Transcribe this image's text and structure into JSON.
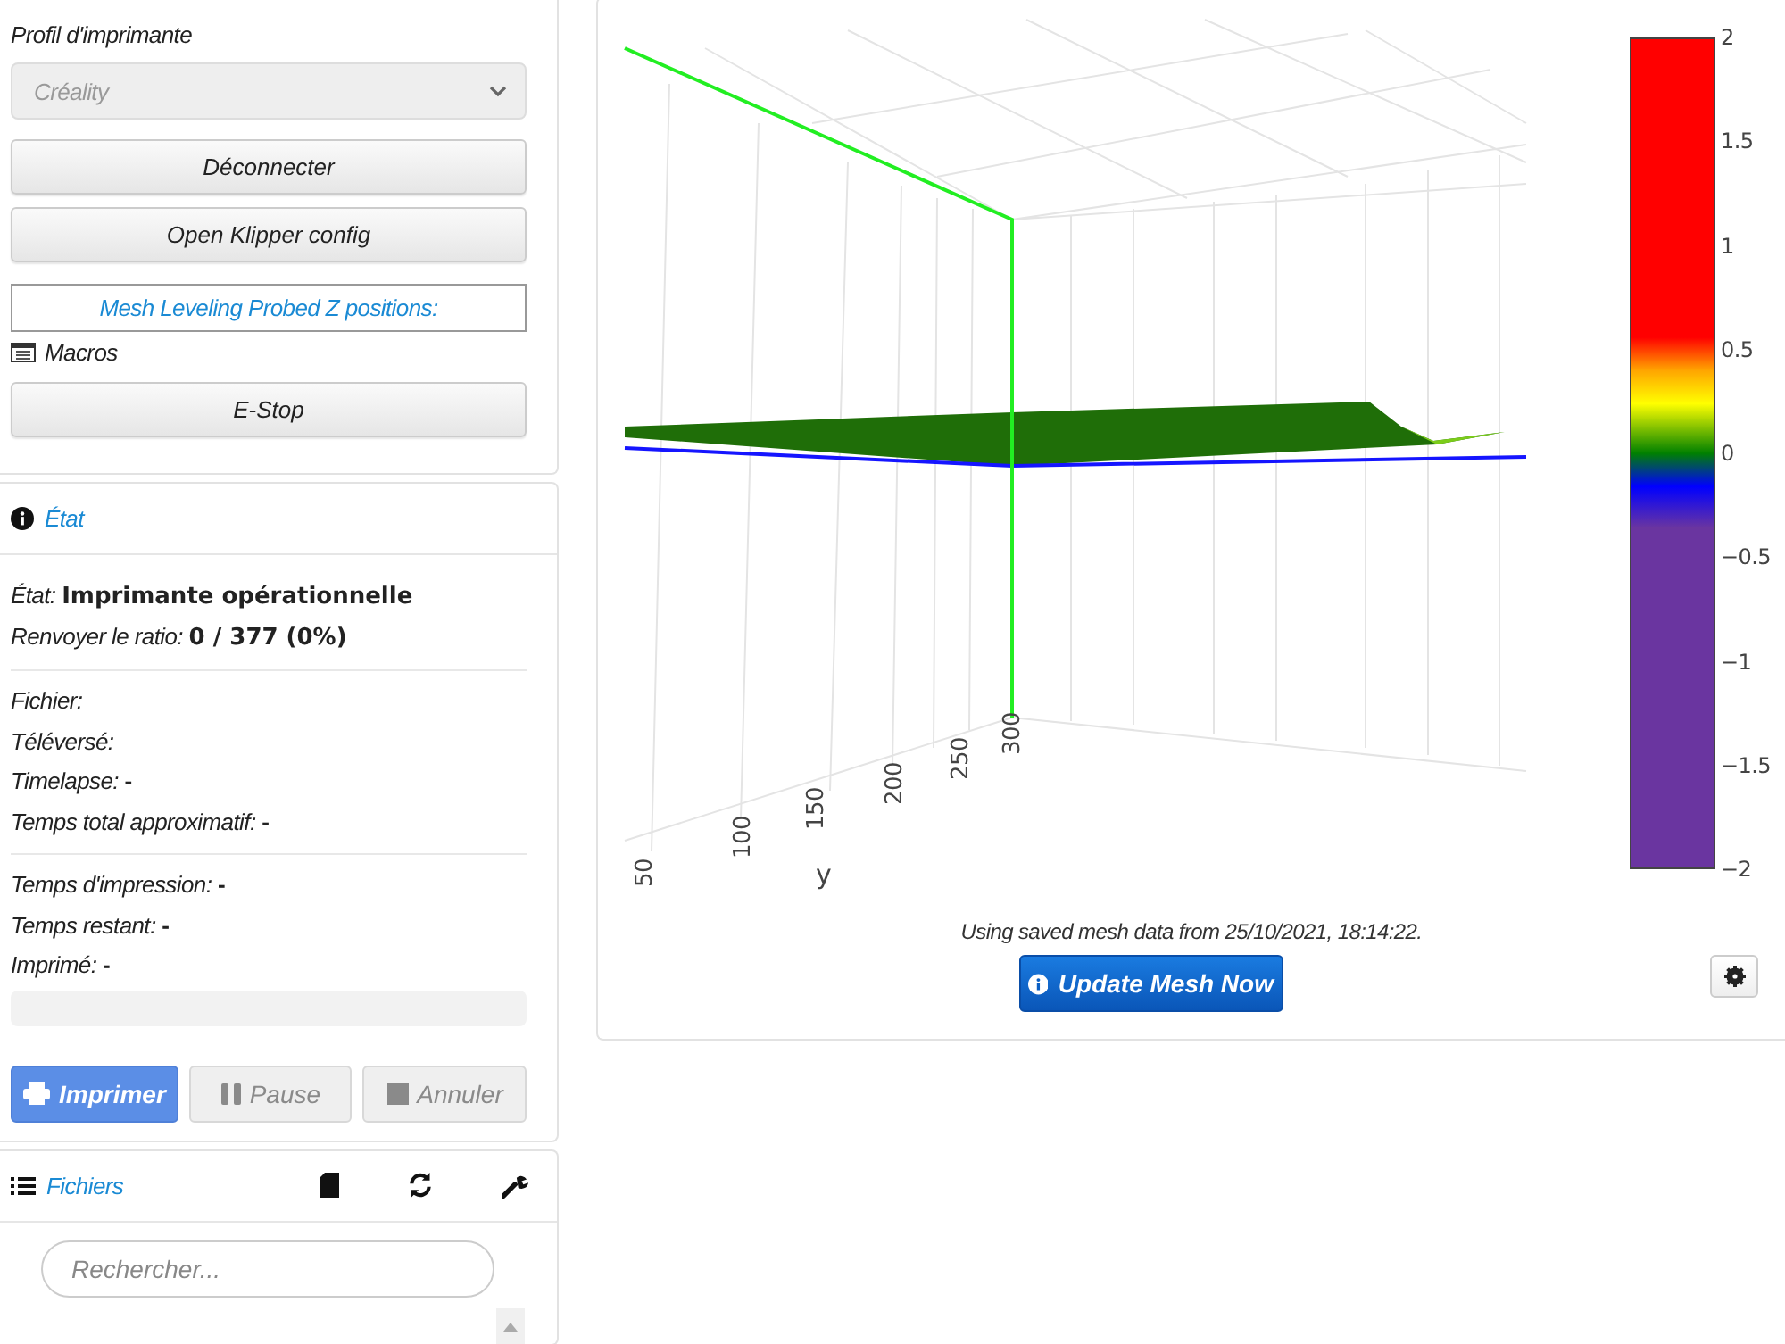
{
  "printer_panel": {
    "profile_label": "Profil d'imprimante",
    "profile_select": {
      "value": "Créality",
      "disabled": true
    },
    "buttons": [
      {
        "label": "Déconnecter"
      },
      {
        "label": "Open Klipper config"
      }
    ],
    "mesh_link": "Mesh Leveling Probed Z positions:",
    "macros_label": "Macros",
    "estop_button": "E-Stop"
  },
  "state_panel": {
    "title": "État",
    "status": {
      "label": "État:",
      "value": "Imprimante opérationnelle"
    },
    "ratio": {
      "label": "Renvoyer le ratio:",
      "value": "0 / 377 (0%)"
    },
    "groups": [
      [
        "*Fichier:*",
        "*Téléversé:*",
        "*Timelapse:* **-**",
        "*Temps total approximatif:* **-**"
      ],
      [
        "*Temps d'impression:* **-**",
        "*Temps restant:* **-**",
        "*Imprimé:* **-**"
      ]
    ],
    "progress": {
      "level": 0
    },
    "actions": [
      {
        "label": "Imprimer",
        "kind": "primary",
        "disabled": false
      },
      {
        "label": "Pause",
        "kind": "default",
        "disabled": true
      },
      {
        "label": "Annuler",
        "kind": "default",
        "disabled": true
      }
    ]
  },
  "files_panel": {
    "title": "Fichiers",
    "search": {
      "placeholder": "Rechercher..."
    }
  },
  "mesh_panel": {
    "y_axis": {
      "title": "y",
      "ticks": [
        "50",
        "100",
        "150",
        "200",
        "250",
        "300"
      ]
    },
    "colorbar_ticks": [
      "2",
      "1.5",
      "1",
      "0.5",
      "0",
      "−0.5",
      "−1",
      "−1.5",
      "−2"
    ],
    "note": "Using saved mesh data from 25/10/2021, 18:14:22.",
    "update_button": "Update Mesh Now"
  }
}
